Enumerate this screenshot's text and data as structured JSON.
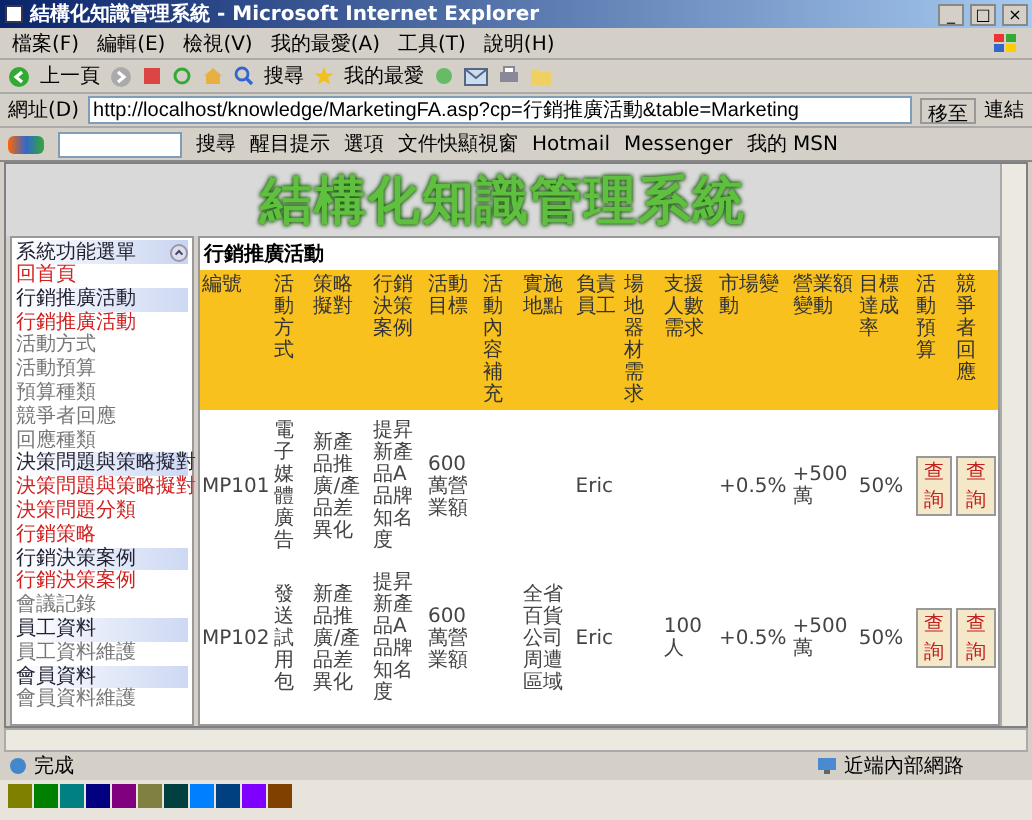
{
  "window": {
    "title": "結構化知識管理系統 - Microsoft Internet Explorer",
    "controls": [
      "_",
      "□",
      "×"
    ]
  },
  "menu": [
    "檔案(F)",
    "編輯(E)",
    "檢視(V)",
    "我的最愛(A)",
    "工具(T)",
    "說明(H)"
  ],
  "toolbar": [
    {
      "label": "上一頁"
    },
    {
      "label": "搜尋"
    },
    {
      "label": "我的最愛"
    }
  ],
  "address": {
    "label": "網址(D)",
    "value": "http://localhost/knowledge/MarketingFA.asp?cp=行銷推廣活動&table=Marketing",
    "go": "移至",
    "links": "連結"
  },
  "msn_bar": [
    "搜尋",
    "醒目提示",
    "選項",
    "文件快顯視窗",
    "Hotmail",
    "Messenger",
    "我的 MSN"
  ],
  "banner": "結構化知識管理系統",
  "sidebar": {
    "title": "系統功能選單",
    "items": [
      {
        "label": "回首頁",
        "kind": "link"
      },
      {
        "label": "行銷推廣活動",
        "kind": "header"
      },
      {
        "label": "行銷推廣活動",
        "kind": "link"
      },
      {
        "label": "活動方式",
        "kind": "sub"
      },
      {
        "label": "活動預算",
        "kind": "sub"
      },
      {
        "label": "預算種類",
        "kind": "sub"
      },
      {
        "label": "競爭者回應",
        "kind": "sub"
      },
      {
        "label": "回應種類",
        "kind": "sub"
      },
      {
        "label": "決策問題與策略擬對",
        "kind": "header"
      },
      {
        "label": "決策問題與策略擬對",
        "kind": "link"
      },
      {
        "label": "決策問題分類",
        "kind": "link"
      },
      {
        "label": "行銷策略",
        "kind": "link"
      },
      {
        "label": "行銷決策案例",
        "kind": "header"
      },
      {
        "label": "行銷決策案例",
        "kind": "link"
      },
      {
        "label": "會議記錄",
        "kind": "sub"
      },
      {
        "label": "員工資料",
        "kind": "header"
      },
      {
        "label": "員工資料維護",
        "kind": "sub"
      },
      {
        "label": "會員資料",
        "kind": "header"
      },
      {
        "label": "會員資料維護",
        "kind": "sub"
      }
    ]
  },
  "table": {
    "title": "行銷推廣活動",
    "columns": [
      "編號",
      "活動方式",
      "策略擬對",
      "行銷決策案例",
      "活動目標",
      "活動內容補充",
      "實施地點",
      "負責員工",
      "場地器材需求",
      "支援人數需求",
      "市場變動",
      "營業額變動",
      "目標達成率",
      "活動預算",
      "競爭者回應"
    ],
    "rows": [
      {
        "cells": [
          "MP101",
          "電子媒體廣告",
          "新產品推廣/產品差異化",
          "提昇新產品A品牌知名度",
          "600萬營業額",
          "",
          "",
          "Eric",
          "",
          "",
          "+0.5%",
          "+500萬",
          "50%"
        ],
        "buttons": [
          "查詢",
          "查詢"
        ]
      },
      {
        "cells": [
          "MP102",
          "發送試用包",
          "新產品推廣/產品差異化",
          "提昇新產品A品牌知名度",
          "600萬營業額",
          "",
          "全省百貨公司周遭區域",
          "Eric",
          "",
          "100人",
          "+0.5%",
          "+500萬",
          "50%"
        ],
        "buttons": [
          "查詢",
          "查詢"
        ]
      }
    ]
  },
  "status_bar": {
    "text": "完成",
    "zone": "近端內部網路"
  },
  "palette": [
    {
      "color": "#808000"
    },
    {
      "color": "#008000"
    },
    {
      "color": "#008080"
    },
    {
      "color": "#000080"
    },
    {
      "color": "#800080"
    },
    {
      "color": "#808040"
    },
    {
      "color": "#004040"
    },
    {
      "color": "#0080ff"
    },
    {
      "color": "#004080"
    },
    {
      "color": "#8000ff"
    },
    {
      "color": "#804000"
    }
  ]
}
